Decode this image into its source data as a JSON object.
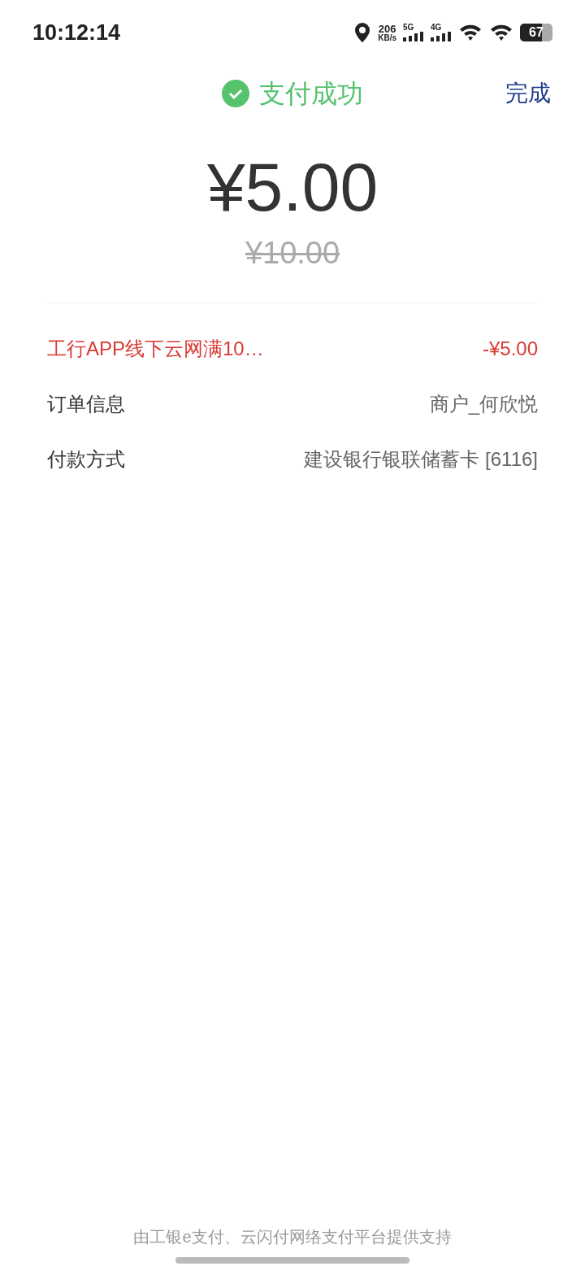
{
  "status_bar": {
    "time": "10:12:14",
    "net_speed": "206",
    "net_unit": "KB/s",
    "sim_1": "5G",
    "sim_2": "4G",
    "battery": "67"
  },
  "header": {
    "title": "支付成功",
    "done_button": "完成"
  },
  "amount": {
    "paid": "¥5.00",
    "original": "¥10.00"
  },
  "rows": [
    {
      "kind": "discount",
      "label": "工行APP线下云网满10…",
      "value": "-¥5.00"
    },
    {
      "kind": "info",
      "label": "订单信息",
      "value": "商户_何欣悦"
    },
    {
      "kind": "info",
      "label": "付款方式",
      "value": "建设银行银联储蓄卡 [6116]"
    }
  ],
  "footer": "由工银e支付、云闪付网络支付平台提供支持"
}
